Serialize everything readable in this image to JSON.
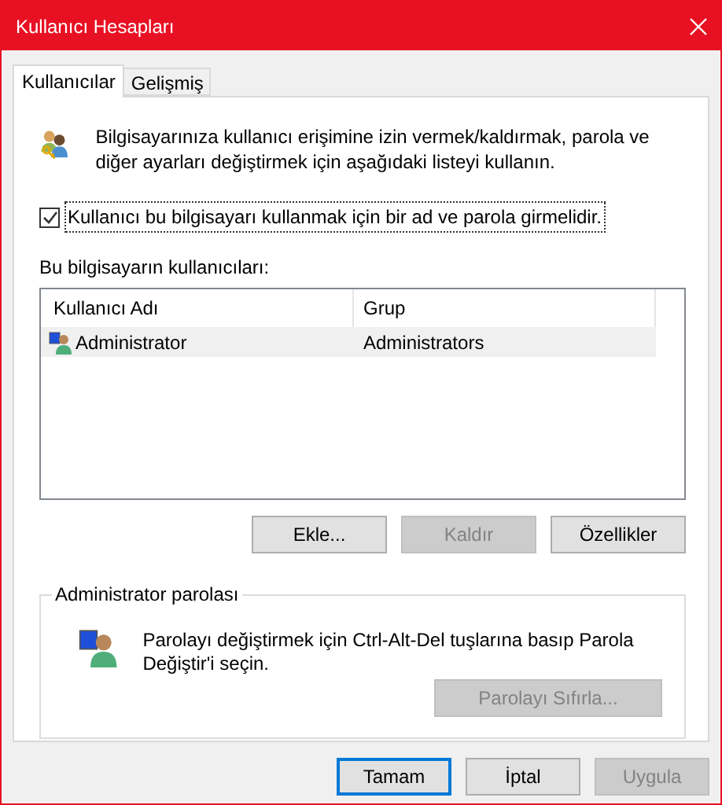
{
  "window": {
    "title": "Kullanıcı Hesapları"
  },
  "tabs": [
    {
      "label": "Kullanıcılar",
      "selected": true
    },
    {
      "label": "Gelişmiş",
      "selected": false
    }
  ],
  "intro": "Bilgisayarınıza kullanıcı erişimine izin vermek/kaldırmak, parola ve diğer ayarları değiştirmek için aşağıdaki listeyi kullanın.",
  "require_password": {
    "label": "Kullanıcı bu bilgisayarı kullanmak için bir ad ve parola girmelidir.",
    "checked": true
  },
  "users_label": "Bu bilgisayarın kullanıcıları:",
  "table": {
    "columns": [
      "Kullanıcı Adı",
      "Grup"
    ],
    "rows": [
      {
        "cells": [
          "Administrator",
          "Administrators"
        ],
        "selected": true
      }
    ]
  },
  "list_buttons": [
    {
      "label": "Ekle...",
      "disabled": false
    },
    {
      "label": "Kaldır",
      "disabled": true
    },
    {
      "label": "Özellikler",
      "disabled": false
    }
  ],
  "password_group": {
    "title": "Administrator parolası",
    "text": "Parolayı değiştirmek için Ctrl-Alt-Del tuşlarına basıp Parola Değiştir'i seçin.",
    "button": {
      "label": "Parolayı Sıfırla...",
      "disabled": true
    }
  },
  "dialog_buttons": [
    {
      "label": "Tamam",
      "disabled": false,
      "default": true
    },
    {
      "label": "İptal",
      "disabled": false,
      "default": false
    },
    {
      "label": "Uygula",
      "disabled": true,
      "default": false
    }
  ]
}
